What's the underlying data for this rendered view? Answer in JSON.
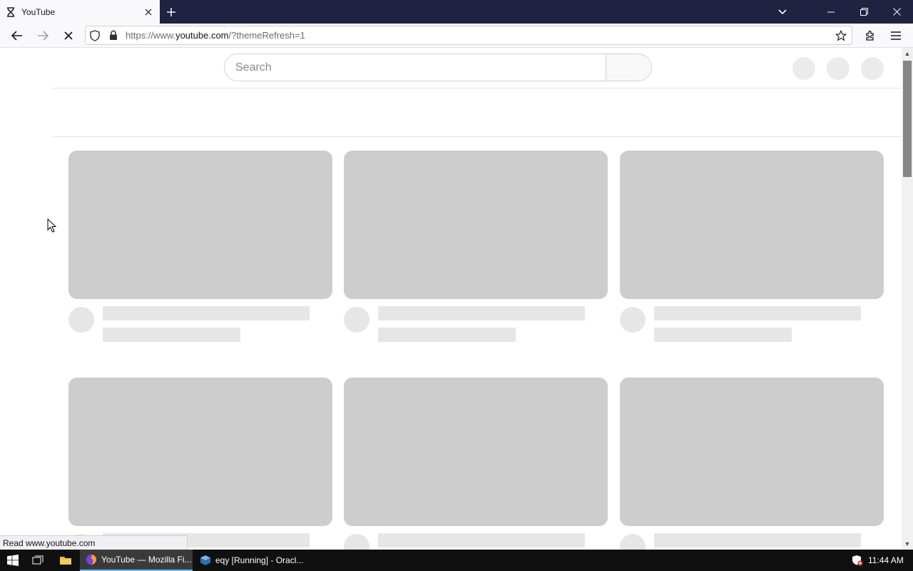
{
  "browser": {
    "tab": {
      "title": "YouTube",
      "favicon": "hourglass-icon"
    },
    "url": {
      "prefix": "https://www.",
      "domain": "youtube.com",
      "suffix": "/?themeRefresh=1"
    },
    "status_tip": "Read www.youtube.com"
  },
  "youtube": {
    "search_placeholder": "Search",
    "skeleton_rows": 2,
    "skeleton_columns": 3
  },
  "taskbar": {
    "apps": [
      {
        "label": "YouTube — Mozilla Fi...",
        "icon": "firefox-icon",
        "active": true
      },
      {
        "label": "eqy [Running] - Oracl...",
        "icon": "virtualbox-icon",
        "active": false
      }
    ],
    "clock": "11:44 AM"
  },
  "colors": {
    "tabstrip_bg": "#1f2240",
    "skeleton_thumb": "#cdcdcd",
    "skeleton_text": "#e6e6e6",
    "taskbar_bg": "#101010"
  }
}
